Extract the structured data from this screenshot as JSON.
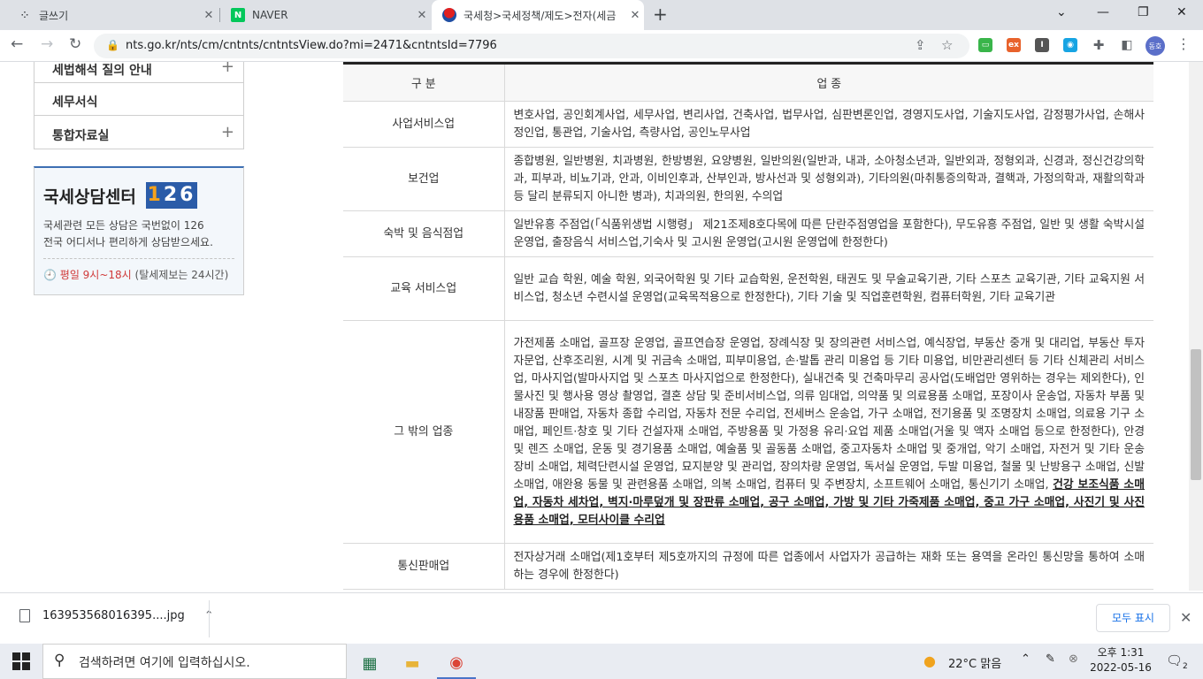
{
  "browser": {
    "tabs": [
      {
        "label": "글쓰기",
        "icon": "tistory-icon"
      },
      {
        "label": "NAVER",
        "icon": "naver-icon"
      },
      {
        "label": "국세청>국세정책/제도>전자(세금",
        "icon": "nts-icon"
      }
    ],
    "url": "nts.go.kr/nts/cm/cntnts/cntntsView.do?mi=2471&cntntsId=7796",
    "profile_label": "동호"
  },
  "sidebar": {
    "items": [
      {
        "label": "세법해석 질의 안내"
      },
      {
        "label": "세무서식"
      },
      {
        "label": "통합자료실"
      }
    ],
    "center": {
      "title": "국세상담센터",
      "number_a": "1",
      "number_b": "26",
      "desc_line1": "국세관련 모든 상담은 국번없이 126",
      "desc_line2": "전국 어디서나 편리하게 상담받으세요.",
      "hours_red": "평일 9시~18시",
      "hours_rest": "(탈세제보는 24시간)"
    }
  },
  "table": {
    "headers": {
      "category": "구 분",
      "industry": "업 종"
    },
    "rows": [
      {
        "category": "사업서비스업",
        "industry": "변호사업, 공인회계사업, 세무사업, 변리사업, 건축사업, 법무사업, 심판변론인업, 경영지도사업, 기술지도사업, 감정평가사업, 손해사정인업, 통관업, 기술사업, 측량사업, 공인노무사업"
      },
      {
        "category": "보건업",
        "industry": "종합병원, 일반병원, 치과병원, 한방병원, 요양병원, 일반의원(일반과, 내과, 소아청소년과, 일반외과, 정형외과, 신경과, 정신건강의학과, 피부과, 비뇨기과, 안과, 이비인후과, 산부인과, 방사선과 및 성형외과), 기타의원(마취통증의학과, 결핵과, 가정의학과, 재활의학과 등 달리 분류되지 아니한 병과), 치과의원, 한의원, 수의업"
      },
      {
        "category": "숙박 및 음식점업",
        "industry": "일반유흥 주점업(「식품위생법 시행령」 제21조제8호다목에 따른 단란주점영업을 포함한다), 무도유흥 주점업, 일반 및 생활 숙박시설 운영업, 출장음식 서비스업,기숙사 및 고시원 운영업(고시원 운영업에 한정한다)"
      },
      {
        "category": "교육 서비스업",
        "industry": "일반 교습 학원, 예술 학원, 외국어학원 및 기타 교습학원, 운전학원, 태권도 및 무술교육기관, 기타 스포츠 교육기관, 기타 교육지원 서비스업, 청소년 수련시설 운영업(교육목적용으로 한정한다), 기타 기술 및 직업훈련학원, 컴퓨터학원, 기타 교육기관"
      },
      {
        "category": "그 밖의 업종",
        "industry": "가전제품 소매업, 골프장 운영업, 골프연습장 운영업, 장례식장 및 장의관련 서비스업, 예식장업, 부동산 중개 및 대리업, 부동산 투자 자문업, 산후조리원, 시계 및 귀금속 소매업, 피부미용업, 손·발톱 관리 미용업 등 기타 미용업, 비만관리센터 등 기타 신체관리 서비스업, 마사지업(발마사지업 및 스포츠 마사지업으로 한정한다), 실내건축 및 건축마무리 공사업(도배업만 영위하는 경우는 제외한다), 인물사진 및 행사용 영상 촬영업, 결혼 상담 및 준비서비스업, 의류 임대업, 의약품 및 의료용품 소매업, 포장이사 운송업, 자동차 부품 및 내장품 판매업, 자동차 종합 수리업, 자동차 전문 수리업, 전세버스 운송업, 가구 소매업, 전기용품 및 조명장치 소매업, 의료용 기구 소매업, 페인트·창호 및 기타 건설자재 소매업, 주방용품 및 가정용 유리·요업 제품 소매업(거울 및 액자 소매업 등으로 한정한다), 안경 및 렌즈 소매업, 운동 및 경기용품 소매업, 예술품 및 골동품 소매업, 중고자동차 소매업 및 중개업, 악기 소매업, 자전거 및 기타 운송장비 소매업, 체력단련시설 운영업, 묘지분양 및 관리업, 장의차량 운영업, 독서실 운영업, 두발 미용업, 철물 및 난방용구 소매업, 신발 소매업, 애완용 동물 및 관련용품 소매업, 의복 소매업, 컴퓨터 및 주변장치, 소프트웨어 소매업, 통신기기 소매업, ",
        "industry_underlined": "건강 보조식품 소매업, 자동차 세차업, 벽지·마루덮개 및 장판류 소매업, 공구 소매업, 가방 및 기타 가죽제품 소매업, 중고 가구 소매업, 사진기 및 사진용품 소매업, 모터사이클 수리업"
      },
      {
        "category": "통신판매업",
        "industry": "전자상거래 소매업(제1호부터 제5호까지의 규정에 따른 업종에서 사업자가 공급하는 재화 또는 용역을 온라인 통신망을 통하여 소매하는 경우에 한정한다)"
      }
    ]
  },
  "downloads": {
    "file": "163953568016395....jpg",
    "show_all": "모두 표시"
  },
  "taskbar": {
    "search_placeholder": "검색하려면 여기에 입력하십시오.",
    "weather": "22°C  맑음",
    "time": "오후 1:31",
    "date": "2022-05-16",
    "notif_count": "2"
  }
}
